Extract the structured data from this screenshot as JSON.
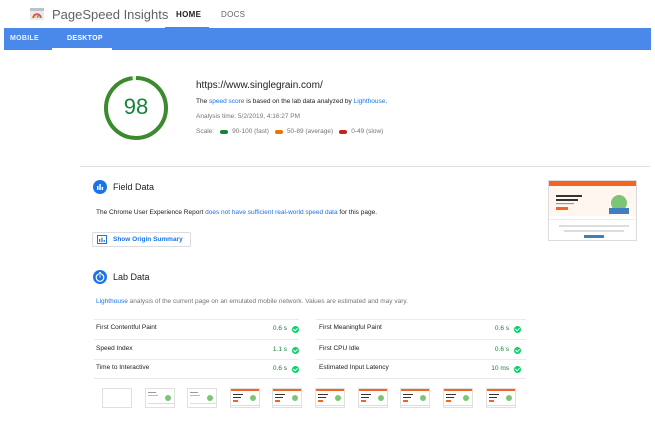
{
  "header": {
    "app_title": "PageSpeed Insights",
    "nav": {
      "home": "HOME",
      "docs": "DOCS"
    }
  },
  "tabs": {
    "mobile": "MOBILE",
    "desktop": "DESKTOP"
  },
  "summary": {
    "score": "98",
    "url": "https://www.singlegrain.com/",
    "desc_pre": "The ",
    "desc_link1": "speed score",
    "desc_mid": " is based on the lab data analyzed by ",
    "desc_link2": "Lighthouse",
    "desc_post": ".",
    "analysis_time": "Analysis time: 5/2/2019, 4:16:27 PM",
    "scale_label": "Scale:",
    "scale_fast": "90-100 (fast)",
    "scale_average": "50-89 (average)",
    "scale_slow": "0-49 (slow)",
    "colors": {
      "fast": "#178239",
      "average": "#e67700",
      "slow": "#c7221f"
    }
  },
  "field_data": {
    "title": "Field Data",
    "text_pre": "The Chrome User Experience Report ",
    "text_link": "does not have sufficient real-world speed data",
    "text_post": " for this page.",
    "origin_button": "Show Origin Summary"
  },
  "lab_data": {
    "title": "Lab Data",
    "text_link": "Lighthouse",
    "text_post": " analysis of the current page on an emulated mobile network. Values are estimated and may vary.",
    "metrics_left": [
      {
        "name": "First Contentful Paint",
        "value": "0.6 s"
      },
      {
        "name": "Speed Index",
        "value": "1.1 s"
      },
      {
        "name": "Time to Interactive",
        "value": "0.6 s"
      }
    ],
    "metrics_right": [
      {
        "name": "First Meaningful Paint",
        "value": "0.6 s"
      },
      {
        "name": "First CPU Idle",
        "value": "0.6 s"
      },
      {
        "name": "Estimated Input Latency",
        "value": "10 ms"
      }
    ]
  },
  "icons": {
    "logo": "pagespeed-logo",
    "field": "bar-chart-icon",
    "lab": "stopwatch-icon",
    "origin": "report-icon",
    "check": "check-circle-icon"
  }
}
